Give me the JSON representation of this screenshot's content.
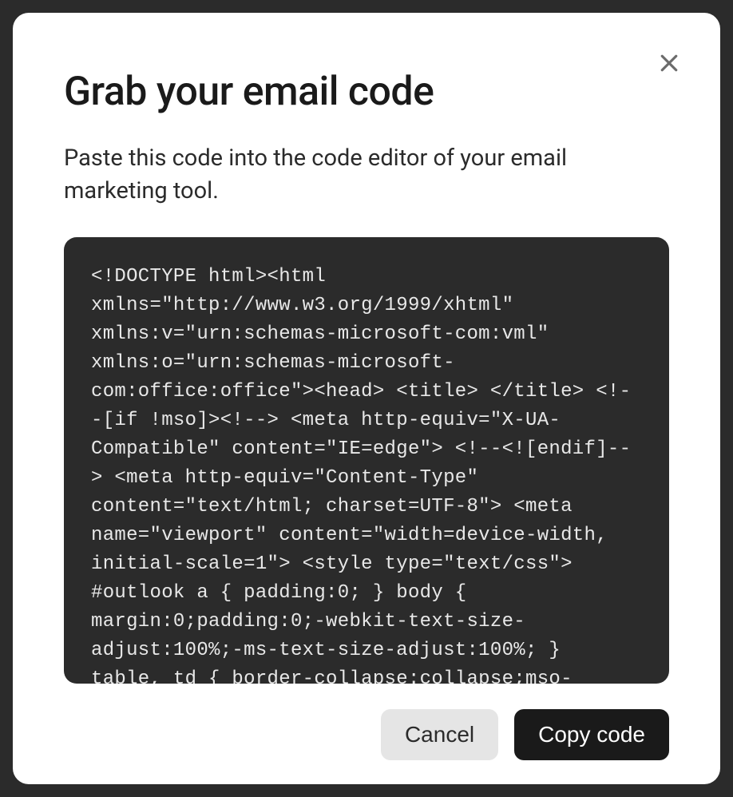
{
  "modal": {
    "title": "Grab your email code",
    "subtitle": "Paste this code into the code editor of your email marketing tool.",
    "code_content": "<!DOCTYPE html><html xmlns=\"http://www.w3.org/1999/xhtml\" xmlns:v=\"urn:schemas-microsoft-com:vml\" xmlns:o=\"urn:schemas-microsoft-com:office:office\"><head> <title> </title> <!--[if !mso]><!--> <meta http-equiv=\"X-UA-Compatible\" content=\"IE=edge\"> <!--<![endif]--> <meta http-equiv=\"Content-Type\" content=\"text/html; charset=UTF-8\"> <meta name=\"viewport\" content=\"width=device-width, initial-scale=1\"> <style type=\"text/css\"> #outlook a { padding:0; } body { margin:0;padding:0;-webkit-text-size-adjust:100%;-ms-text-size-adjust:100%; } table, td { border-collapse:collapse;mso-table-",
    "buttons": {
      "cancel_label": "Cancel",
      "copy_label": "Copy code"
    }
  }
}
